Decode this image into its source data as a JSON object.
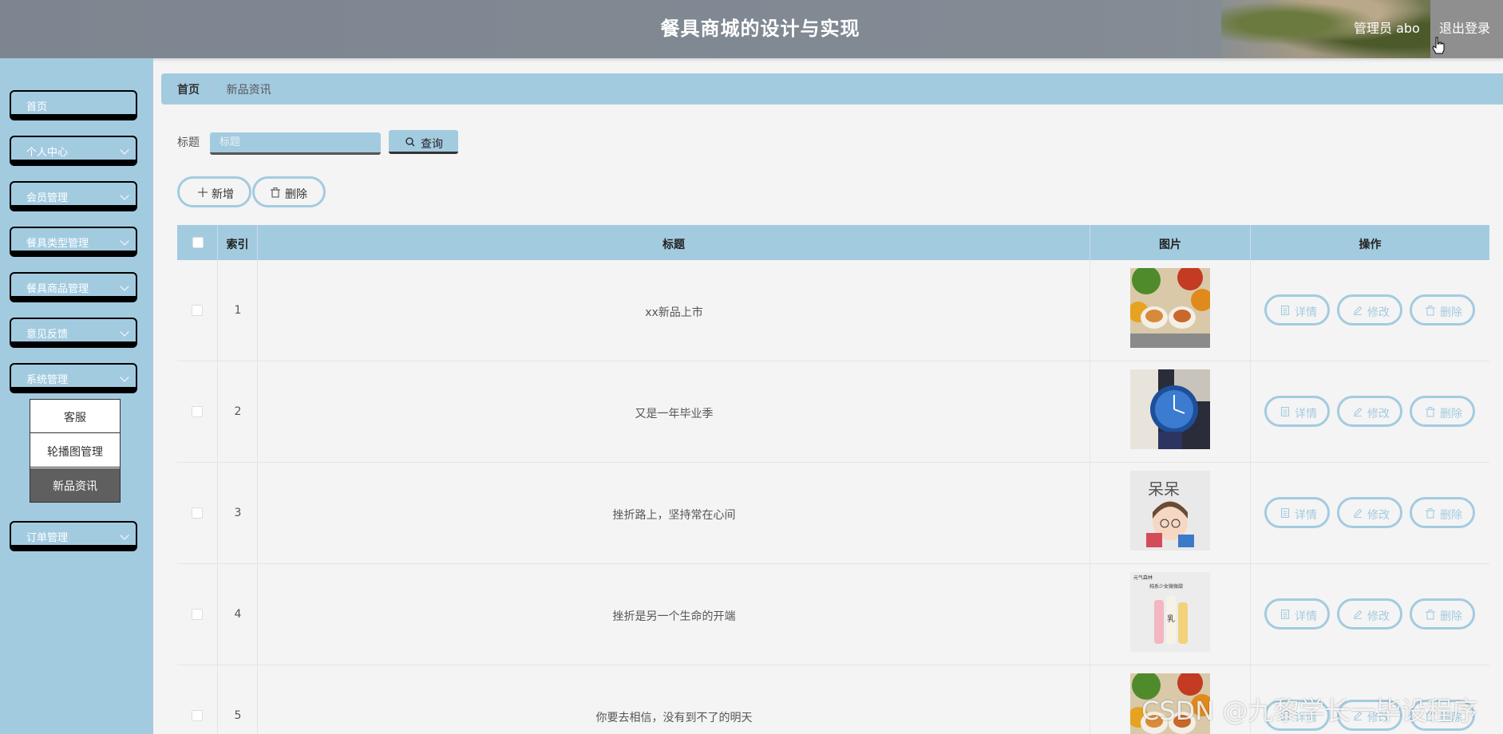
{
  "header": {
    "title": "餐具商城的设计与实现",
    "admin_label": "管理员 abo",
    "logout_label": "退出登录"
  },
  "sidebar": {
    "items": [
      {
        "label": "首页",
        "expandable": false
      },
      {
        "label": "个人中心",
        "expandable": true
      },
      {
        "label": "会员管理",
        "expandable": true
      },
      {
        "label": "餐具类型管理",
        "expandable": true
      },
      {
        "label": "餐具商品管理",
        "expandable": true
      },
      {
        "label": "意见反馈",
        "expandable": true
      },
      {
        "label": "系统管理",
        "expandable": true
      },
      {
        "label": "订单管理",
        "expandable": true
      }
    ],
    "submenu": [
      {
        "label": "客服",
        "active": false
      },
      {
        "label": "轮播图管理",
        "active": false
      },
      {
        "label": "新品资讯",
        "active": true
      }
    ]
  },
  "breadcrumb": {
    "home": "首页",
    "separator": "/",
    "current": "新品资讯"
  },
  "search": {
    "label": "标题",
    "placeholder": "标题",
    "button_label": "查询"
  },
  "actions": {
    "add_label": "新增",
    "delete_label": "删除"
  },
  "table": {
    "columns": [
      "索引",
      "标题",
      "图片",
      "操作"
    ],
    "rows": [
      {
        "index": "1",
        "title": "xx新品上市",
        "image": "food-bowls"
      },
      {
        "index": "2",
        "title": "又是一年毕业季",
        "image": "watch"
      },
      {
        "index": "3",
        "title": "挫折路上，坚持常在心间",
        "image": "cartoon-girl"
      },
      {
        "index": "4",
        "title": "挫折是另一个生命的开端",
        "image": "drink-bottles"
      },
      {
        "index": "5",
        "title": "你要去相信，没有到不了的明天",
        "image": "food-bowls"
      }
    ],
    "row_actions": {
      "detail": "详情",
      "edit": "修改",
      "delete": "删除"
    }
  },
  "watermark": "CSDN @九黎学长一毕设程序",
  "colors": {
    "accent": "#a3cbe0",
    "header": "#828a94",
    "active_submenu": "#5f5f5f"
  }
}
